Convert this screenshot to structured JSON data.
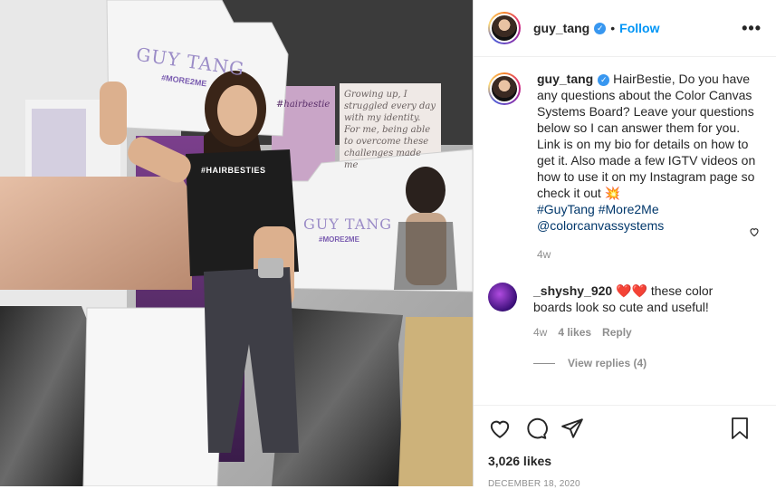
{
  "post": {
    "username": "guy_tang",
    "follow_label": "Follow",
    "more_label": "•••",
    "caption": "HairBestie, Do you have any questions about the Color Canvas Systems Board? Leave your questions below so I can answer them for you. Link is on my bio for details on how to get it. Also made a few IGTV videos on how to use it on my Instagram page so check it out 💥",
    "hashtags": "#GuyTang #More2Me",
    "mention": "@colorcanvassystems",
    "caption_age": "4w",
    "likes": "3,026 likes",
    "date": "DECEMBER 18, 2020"
  },
  "comment": {
    "username": "_shyshy_920",
    "hearts": "❤️❤️",
    "text": "these color boards look so cute and useful!",
    "age": "4w",
    "likes": "4 likes",
    "reply_label": "Reply",
    "view_replies": "View replies (4)"
  },
  "photo": {
    "board_brand": "GUY TANG",
    "board_hashtag": "#MORE2ME",
    "shirt_text": "#HAIRBESTIES",
    "book_left": "#hairbestie",
    "book_right": "Growing up, I struggled every day with my identity. For me, being able to overcome these challenges made me"
  },
  "colors": {
    "accent": "#0095f6",
    "verified": "#3897f0",
    "link": "#00376b",
    "muted": "#8e8e8e",
    "heart": "#e0245e"
  },
  "icons": [
    "heart-icon",
    "comment-icon",
    "share-icon",
    "bookmark-icon",
    "verified-badge-icon",
    "more-options-icon"
  ]
}
